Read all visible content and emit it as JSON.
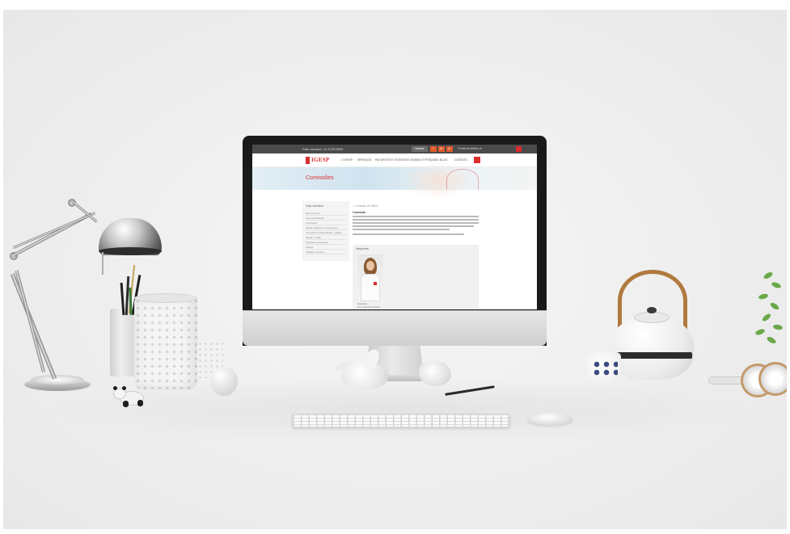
{
  "website": {
    "topbar": {
      "phone": "Fale conosco: 11 2129-5000",
      "search_placeholder": "Buscar",
      "badge_1": "+",
      "badge_2": "A+",
      "badge_3": "A-",
      "link": "Portal do Médico ▾"
    },
    "logo": "IGESP",
    "nav": [
      "O IGESP",
      "SERVIÇOS",
      "PACIENTES E VISITANTES",
      "ENSINO E PESQUISA",
      "BLOG",
      "CONTATO"
    ],
    "banner_title": "Comissões",
    "breadcrumb": "> Comissão de Óbitos",
    "sidebar": {
      "title": "Veja também",
      "items": [
        "Quem Somos",
        "Corpo de Diretoria",
        "Comissões",
        "Saúde Ambiental e Governança",
        "Comissão de Ética Médica – SGPE",
        "Missão e Visão",
        "Programa Compliance",
        "Galeria",
        "Trabalhe Conosco"
      ]
    },
    "content_title": "Comissão",
    "card_label": "Integrantes",
    "caption_1": "Presidente",
    "caption_2": "Dra. Luiza Maria Moraes"
  },
  "colors": {
    "brand_red": "#d82d2d",
    "topbar": "#4b4b4b",
    "accent_orange": "#e05a2b"
  }
}
